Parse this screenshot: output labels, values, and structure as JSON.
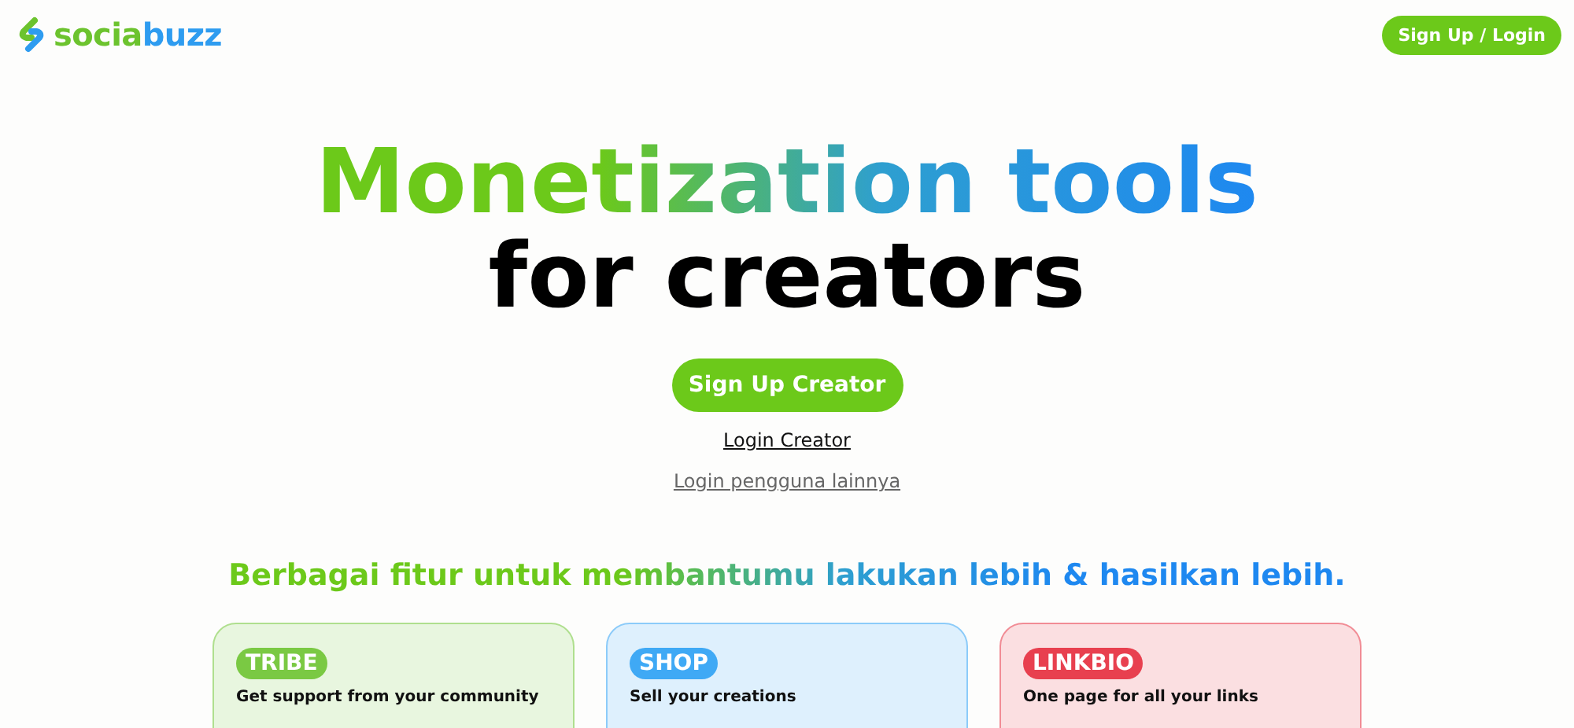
{
  "header": {
    "logo_parts": [
      "socia",
      "buzz"
    ],
    "signup_login": "Sign Up / Login"
  },
  "hero": {
    "headline_line1": "Monetization tools",
    "headline_line2": "for creators",
    "primary_button": "Sign Up Creator",
    "login_creator": "Login Creator",
    "login_other": "Login pengguna lainnya"
  },
  "features": {
    "heading": "Berbagai fitur untuk membantumu lakukan lebih & hasilkan lebih.",
    "cards": [
      {
        "tag": "TRIBE",
        "text": "Get support from your community",
        "color": "#7ac943"
      },
      {
        "tag": "SHOP",
        "text": "Sell your creations",
        "color": "#3fa9f5"
      },
      {
        "tag": "LINKBIO",
        "text": "One page for all your links",
        "color": "#e8404f"
      }
    ]
  }
}
